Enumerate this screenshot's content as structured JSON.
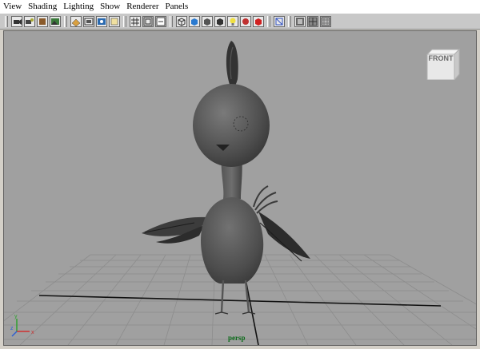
{
  "menubar": {
    "items": [
      {
        "label": "View"
      },
      {
        "label": "Shading"
      },
      {
        "label": "Lighting"
      },
      {
        "label": "Show"
      },
      {
        "label": "Renderer"
      },
      {
        "label": "Panels"
      }
    ]
  },
  "toolbar": {
    "icons": [
      "select-camera-icon",
      "camera-attributes-icon",
      "bookmark-icon",
      "image-plane-icon",
      "grid-icon",
      "film-gate-icon",
      "resolution-gate-icon",
      "gate-mask-icon",
      "field-chart-icon",
      "safe-action-icon",
      "safe-title-icon",
      "wireframe-icon",
      "smooth-shade-icon",
      "flat-shade-icon",
      "bounding-box-icon",
      "use-lights-icon",
      "shadows-icon",
      "high-quality-icon",
      "xray-icon",
      "isolate-icon",
      "wireframe-on-shaded-icon",
      "textured-icon"
    ]
  },
  "viewport": {
    "camera_label": "persp",
    "viewcube_label": "FRONT",
    "background_color": "#a0a0a0",
    "grid_color": "#8a8a8a",
    "axis_colors": {
      "x": "#d03030",
      "y": "#30a030",
      "z": "#3060d0"
    }
  }
}
